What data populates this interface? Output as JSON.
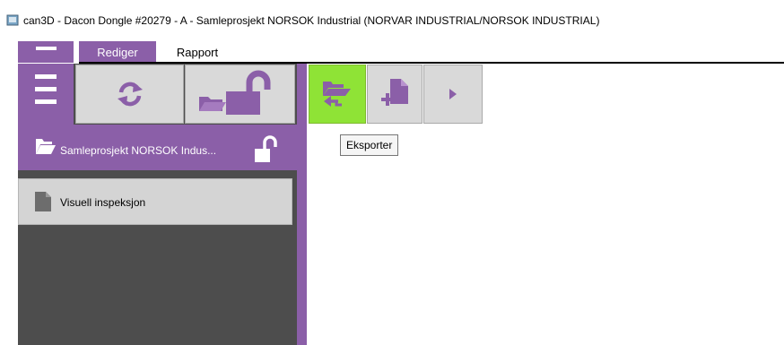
{
  "window": {
    "title": "can3D - Dacon  Dongle #20279 - A - Samleprosjekt NORSOK Industrial (NORVAR INDUSTRIAL/NORSOK INDUSTRIAL)"
  },
  "menu": {
    "items": [
      {
        "label": "Rediger",
        "active": true
      },
      {
        "label": "Rapport",
        "active": false
      }
    ]
  },
  "sidebar": {
    "items": [
      {
        "label": "Samleprosjekt NORSOK Indus...",
        "icon": "folder-open-icon",
        "selected": true,
        "badge_icon": "unlock-icon"
      },
      {
        "label": "Visuell inspeksjon",
        "icon": "document-icon",
        "selected": false
      }
    ]
  },
  "toolbar": {
    "left_buttons": [
      "refresh-icon",
      "unlock-folder-icon"
    ],
    "right_buttons": [
      "export-folder-icon",
      "new-file-icon",
      "play-icon"
    ]
  },
  "tooltip": {
    "text": "Eksporter"
  },
  "colors": {
    "accent": "#8b5fa8",
    "highlight": "#8fe336",
    "panel": "#4d4d4d",
    "button": "#d9d9d9"
  }
}
